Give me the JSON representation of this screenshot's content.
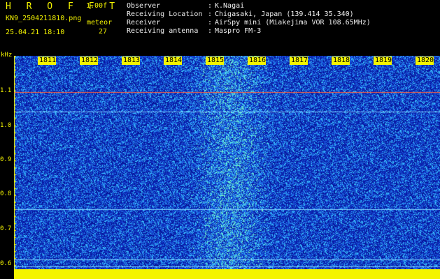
{
  "header": {
    "app_name": "H R O F F T",
    "version": "1.00f",
    "filename": "KN9_2504211810.png",
    "datetime": "25.04.21 18:10",
    "meteor_label": "meteor",
    "meteor_count": "27",
    "info": [
      {
        "label": "Observer",
        "value": "K.Nagai"
      },
      {
        "label": "Receiving Location",
        "value": "Chigasaki, Japan (139.414 35.340)"
      },
      {
        "label": "Receiver",
        "value": "AirSpy mini (Miakejima VOR 108.65MHz)"
      },
      {
        "label": "Receiving antenna",
        "value": "Maspro FM-3"
      }
    ],
    "separator": ":"
  },
  "plot": {
    "y_unit": "kHz",
    "y_ticks": [
      "1.1",
      "1.0",
      "0.9",
      "0.8",
      "0.7",
      "0.6"
    ],
    "x_ticks": [
      "1811",
      "1812",
      "1813",
      "1814",
      "1815",
      "1816",
      "1817",
      "1818",
      "1819",
      "1820"
    ],
    "colors": {
      "background": "#0a1fb4",
      "noise_light": "#3aa6ff",
      "signal": "#50ffb0",
      "axis": "#f4f400",
      "carrier": "#ff6040"
    }
  }
}
